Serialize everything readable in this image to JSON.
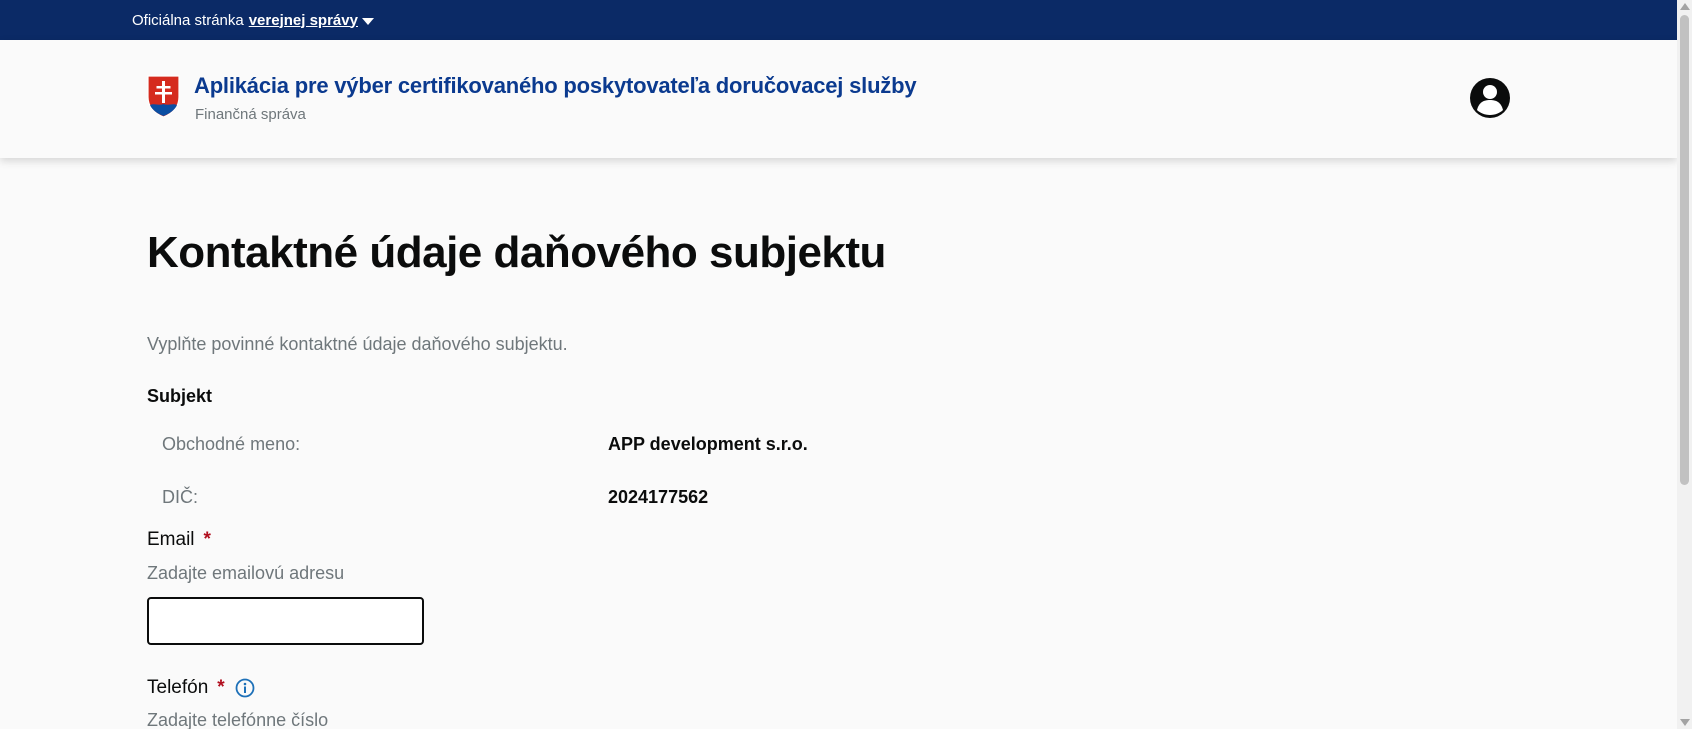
{
  "topbar": {
    "prefix": "Oficiálna stránka",
    "link_label": "verejnej správy"
  },
  "header": {
    "title": "Aplikácia pre výber certifikovaného poskytovateľa doručovacej služby",
    "subtitle": "Finančná správa"
  },
  "main": {
    "title": "Kontaktné údaje daňového subjektu",
    "lead": "Vyplňte povinné kontaktné údaje daňového subjektu.",
    "subject": {
      "heading": "Subjekt",
      "rows": [
        {
          "label": "Obchodné meno:",
          "value": "APP development s.r.o."
        },
        {
          "label": "DIČ:",
          "value": "2024177562"
        }
      ]
    },
    "email": {
      "label": "Email",
      "required_mark": "*",
      "hint": "Zadajte emailovú adresu",
      "value": ""
    },
    "phone": {
      "label": "Telefón",
      "required_mark": "*",
      "hint": "Zadajte telefónne číslo"
    }
  },
  "colors": {
    "top_strip": "#0b2a66",
    "title_blue": "#0b3a8f",
    "required_red": "#b10e1e",
    "info_blue": "#1d70b8"
  },
  "icons": {
    "crest": "slovak-coat-of-arms-icon",
    "user": "user-account-icon",
    "caret": "caret-down-icon",
    "info": "info-circle-icon"
  }
}
